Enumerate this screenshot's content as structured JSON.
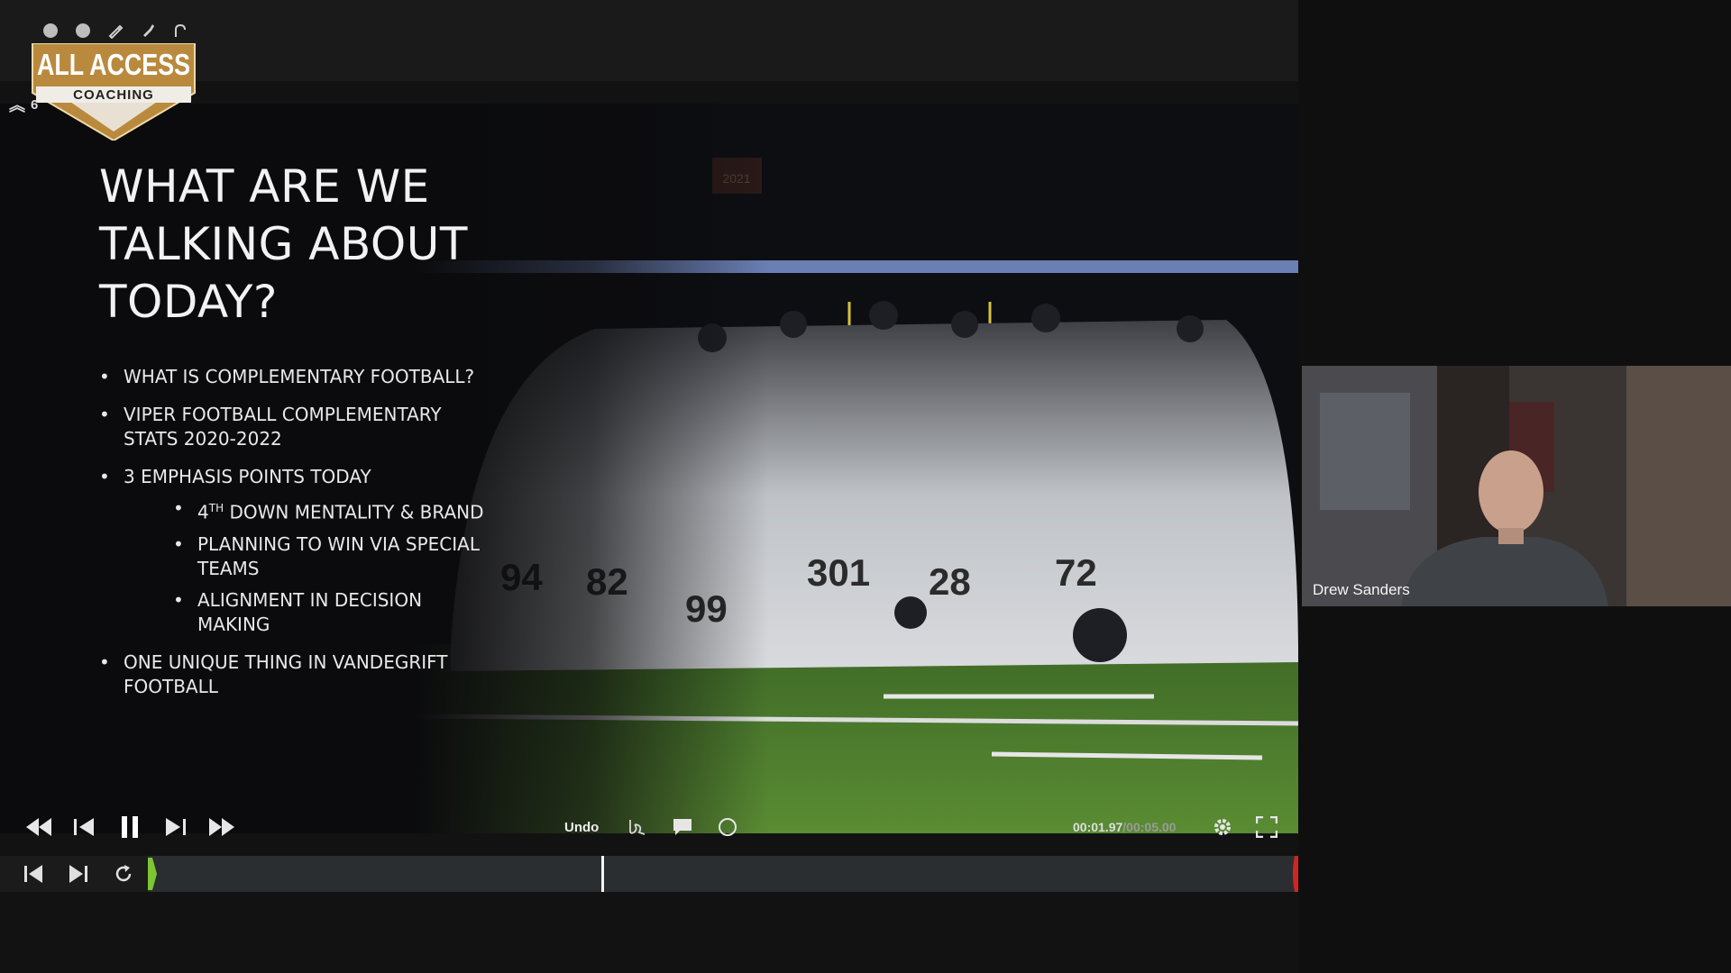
{
  "header": {
    "logo_line1": "ALL ACCESS",
    "logo_line2": "COACHING",
    "page_number": "6",
    "tools": [
      "circle-dot-icon",
      "circle-dot-icon",
      "pen-icon",
      "marker-icon",
      "curve-icon"
    ]
  },
  "slide": {
    "title": "WHAT ARE WE TALKING ABOUT TODAY?",
    "bullets": [
      {
        "text": "WHAT IS COMPLEMENTARY FOOTBALL?"
      },
      {
        "text": "VIPER FOOTBALL COMPLEMENTARY STATS 2020-2022"
      },
      {
        "text": "3 EMPHASIS POINTS TODAY"
      },
      {
        "text": "ONE UNIQUE THING IN VANDEGRIFT FOOTBALL"
      }
    ],
    "sub_bullets": [
      {
        "pre": "4",
        "sup": "TH",
        "post": " DOWN MENTALITY & BRAND"
      },
      {
        "text": "PLANNING TO WIN VIA SPECIAL TEAMS"
      },
      {
        "text": "ALIGNMENT IN DECISION MAKING"
      }
    ],
    "photo": {
      "banner_year": "2021",
      "jersey_numbers": [
        "94",
        "82",
        "99",
        "301",
        "28",
        "72"
      ]
    }
  },
  "controls": {
    "undo_label": "Undo",
    "current_time": "00:01.97",
    "separator": " / ",
    "total_time": "00:05.00",
    "playhead_fraction": 0.394
  },
  "webcam": {
    "name": "Drew Sanders"
  },
  "colors": {
    "logo_gold": "#b98a3e",
    "track_start": "#7ec631",
    "track_end": "#d32424",
    "field_green": "#4f7c2e"
  }
}
